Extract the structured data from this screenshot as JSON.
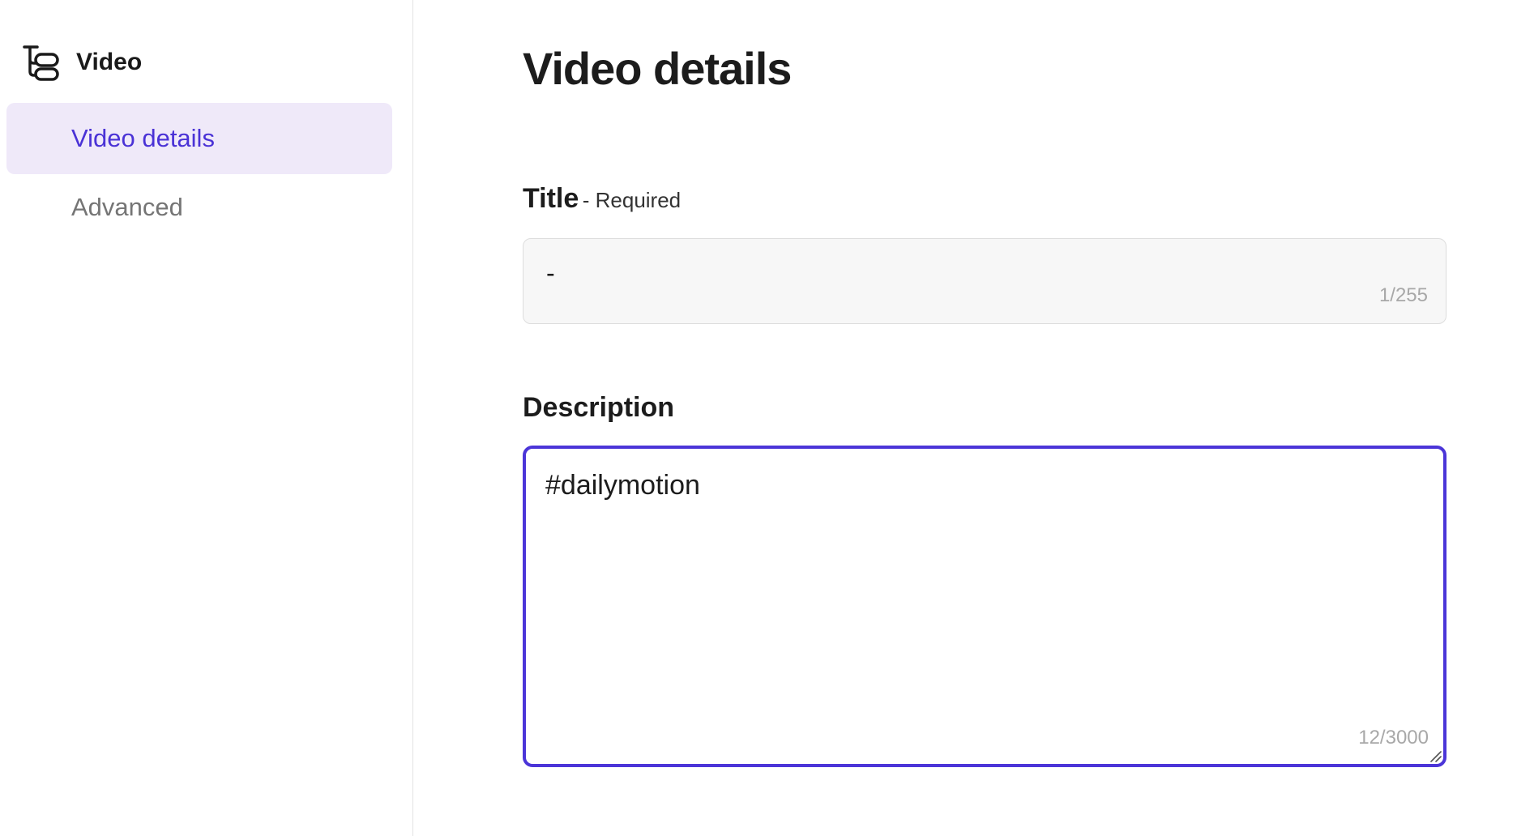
{
  "sidebar": {
    "header": {
      "title": "Video",
      "icon": "tree-structure-icon"
    },
    "items": [
      {
        "label": "Video details",
        "active": true
      },
      {
        "label": "Advanced",
        "active": false
      }
    ]
  },
  "main": {
    "page_title": "Video details",
    "title_field": {
      "label": "Title",
      "required_label": "- Required",
      "value": "-",
      "counter": "1/255"
    },
    "description_field": {
      "label": "Description",
      "value": "#dailymotion",
      "counter": "12/3000"
    }
  },
  "colors": {
    "accent": "#4b35d8",
    "active_nav_bg": "#efe9f9",
    "active_nav_text": "#4a32d6",
    "inactive_nav_text": "#757575",
    "input_bg": "#f7f7f7",
    "counter_text": "#a8a8a8"
  }
}
